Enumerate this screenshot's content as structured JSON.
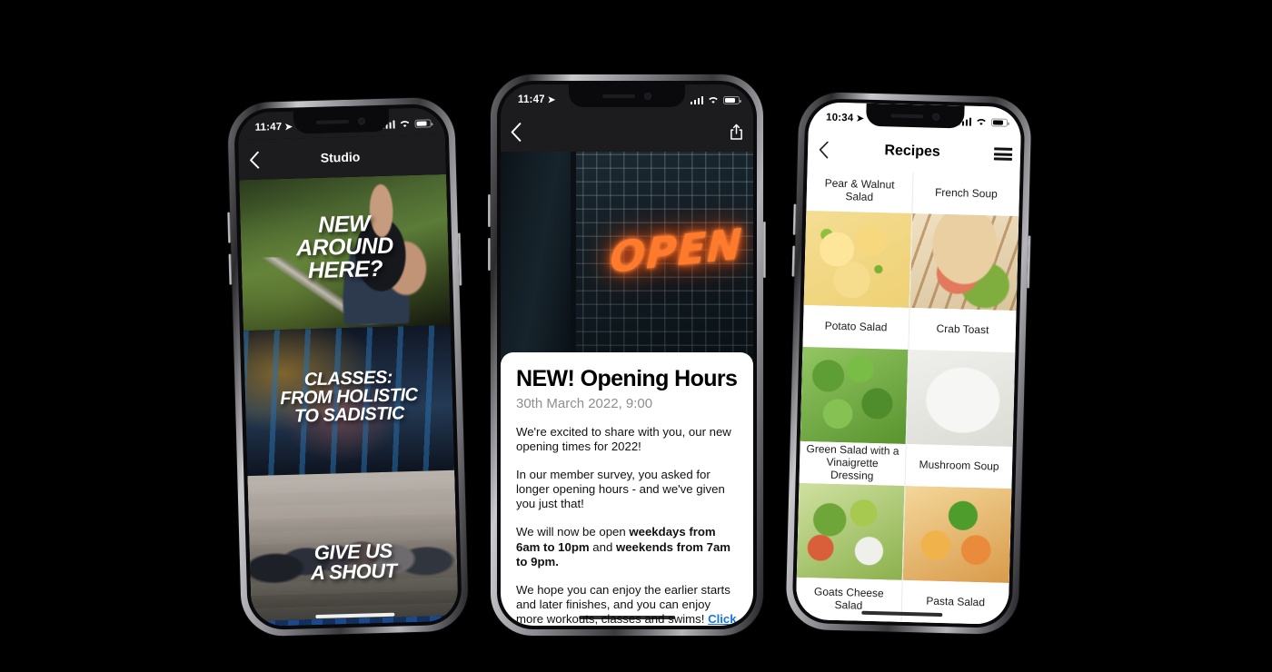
{
  "background_color": "#000000",
  "phones": [
    {
      "id": "studio",
      "status": {
        "time": "11:47",
        "location_icon": "location-arrow-icon",
        "signal_icon": "cellular-bars-icon",
        "wifi_icon": "wifi-icon",
        "battery_icon": "battery-icon"
      },
      "nav": {
        "back_icon": "chevron-left-icon",
        "title": "Studio"
      },
      "cards": [
        {
          "name": "new-around-here",
          "lines": [
            "NEW",
            "AROUND",
            "HERE?"
          ]
        },
        {
          "name": "classes",
          "lines": [
            "CLASSES:",
            "FROM HOLISTIC",
            "TO SADISTIC"
          ]
        },
        {
          "name": "give-us-a-shout",
          "lines": [
            "GIVE US",
            "A SHOUT"
          ]
        },
        {
          "name": "pool",
          "lines": []
        }
      ]
    },
    {
      "id": "article",
      "status": {
        "time": "11:47",
        "location_icon": "location-arrow-icon",
        "signal_icon": "cellular-bars-icon",
        "wifi_icon": "wifi-icon",
        "battery_icon": "battery-icon"
      },
      "nav": {
        "back_icon": "chevron-left-icon",
        "share_icon": "share-icon"
      },
      "hero": {
        "neon_text": "OPEN",
        "neon_color": "#ff7a2a"
      },
      "article": {
        "title": "NEW! Opening Hours",
        "date": "30th March 2022, 9:00",
        "paragraph_1": "We're excited to share with you, our new opening times for 2022!",
        "paragraph_2": "In our member survey, you asked for longer opening hours - and we've given you just that!",
        "paragraph_3_pre": "We will now be open ",
        "paragraph_3_b1": "weekdays from 6am to 10pm",
        "paragraph_3_mid": " and ",
        "paragraph_3_b2": "weekends from 7am to 9pm.",
        "paragraph_4_pre": "We hope you can enjoy the earlier starts and later finishes, and you can enjoy more workouts, classes and swims! ",
        "paragraph_4_link": "Click here to find out more.",
        "link_color": "#1a73e8"
      }
    },
    {
      "id": "recipes",
      "status": {
        "time": "10:34",
        "location_icon": "location-arrow-icon",
        "signal_icon": "cellular-bars-icon",
        "wifi_icon": "wifi-icon",
        "battery_icon": "battery-icon"
      },
      "nav": {
        "back_icon": "chevron-left-icon",
        "title": "Recipes",
        "menu_icon": "hamburger-menu-icon"
      },
      "recipes": [
        {
          "name": "Pear & Walnut Salad",
          "caption_position": "top",
          "thumb": "ph-pear"
        },
        {
          "name": "French Soup",
          "caption_position": "top",
          "thumb": "ph-french"
        },
        {
          "name": "Potato Salad",
          "caption_position": "bottom",
          "thumb": "ph-pear"
        },
        {
          "name": "Crab Toast",
          "caption_position": "bottom",
          "thumb": "ph-french"
        },
        {
          "name": "Green Salad with a Vinaigrette Dressing",
          "caption_position": "bottom",
          "thumb": "ph-green"
        },
        {
          "name": "Mushroom Soup",
          "caption_position": "bottom",
          "thumb": "ph-mushroom"
        },
        {
          "name": "Goats Cheese Salad",
          "caption_position": "bottom",
          "thumb": "ph-goats"
        },
        {
          "name": "Pasta Salad",
          "caption_position": "bottom",
          "thumb": "ph-pasta"
        }
      ]
    }
  ]
}
